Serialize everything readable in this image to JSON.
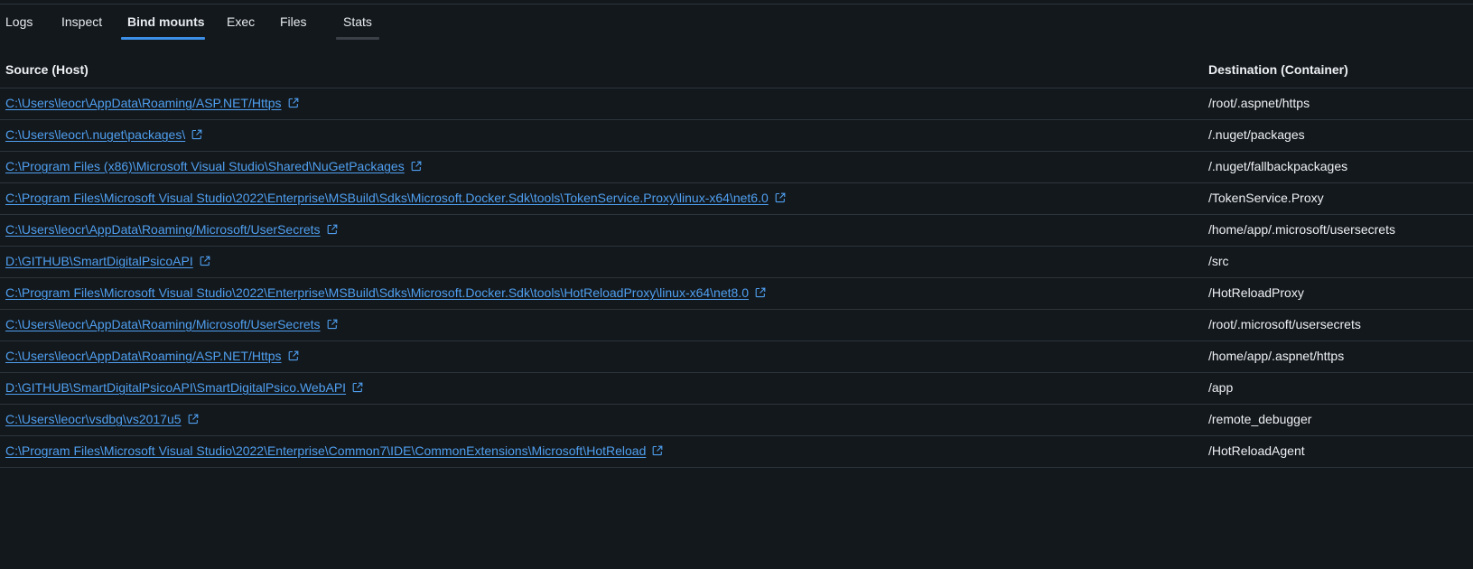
{
  "tabs": [
    {
      "label": "Logs",
      "state": "normal"
    },
    {
      "label": "Inspect",
      "state": "normal"
    },
    {
      "label": "Bind mounts",
      "state": "active"
    },
    {
      "label": "Exec",
      "state": "normal"
    },
    {
      "label": "Files",
      "state": "normal"
    },
    {
      "label": "Stats",
      "state": "hover"
    }
  ],
  "table": {
    "headers": {
      "source": "Source (Host)",
      "destination": "Destination (Container)"
    },
    "rows": [
      {
        "source": "C:\\Users\\leocr\\AppData\\Roaming/ASP.NET/Https",
        "destination": "/root/.aspnet/https"
      },
      {
        "source": "C:\\Users\\leocr\\.nuget\\packages\\",
        "destination": "/.nuget/packages"
      },
      {
        "source": "C:\\Program Files (x86)\\Microsoft Visual Studio\\Shared\\NuGetPackages",
        "destination": "/.nuget/fallbackpackages"
      },
      {
        "source": "C:\\Program Files\\Microsoft Visual Studio\\2022\\Enterprise\\MSBuild\\Sdks\\Microsoft.Docker.Sdk\\tools\\TokenService.Proxy\\linux-x64\\net6.0",
        "destination": "/TokenService.Proxy"
      },
      {
        "source": "C:\\Users\\leocr\\AppData\\Roaming/Microsoft/UserSecrets",
        "destination": "/home/app/.microsoft/usersecrets"
      },
      {
        "source": "D:\\GITHUB\\SmartDigitalPsicoAPI",
        "destination": "/src"
      },
      {
        "source": "C:\\Program Files\\Microsoft Visual Studio\\2022\\Enterprise\\MSBuild\\Sdks\\Microsoft.Docker.Sdk\\tools\\HotReloadProxy\\linux-x64\\net8.0",
        "destination": "/HotReloadProxy"
      },
      {
        "source": "C:\\Users\\leocr\\AppData\\Roaming/Microsoft/UserSecrets",
        "destination": "/root/.microsoft/usersecrets"
      },
      {
        "source": "C:\\Users\\leocr\\AppData\\Roaming/ASP.NET/Https",
        "destination": "/home/app/.aspnet/https"
      },
      {
        "source": "D:\\GITHUB\\SmartDigitalPsicoAPI\\SmartDigitalPsico.WebAPI",
        "destination": "/app"
      },
      {
        "source": "C:\\Users\\leocr\\vsdbg\\vs2017u5",
        "destination": "/remote_debugger"
      },
      {
        "source": "C:\\Program Files\\Microsoft Visual Studio\\2022\\Enterprise\\Common7\\IDE\\CommonExtensions\\Microsoft\\HotReload",
        "destination": "/HotReloadAgent"
      }
    ]
  },
  "icons": {
    "source_link": "external-link-icon"
  },
  "colors": {
    "background": "#13181c",
    "accent": "#3c8ee6",
    "link": "#4f9ff0",
    "divider": "#2d353c"
  }
}
